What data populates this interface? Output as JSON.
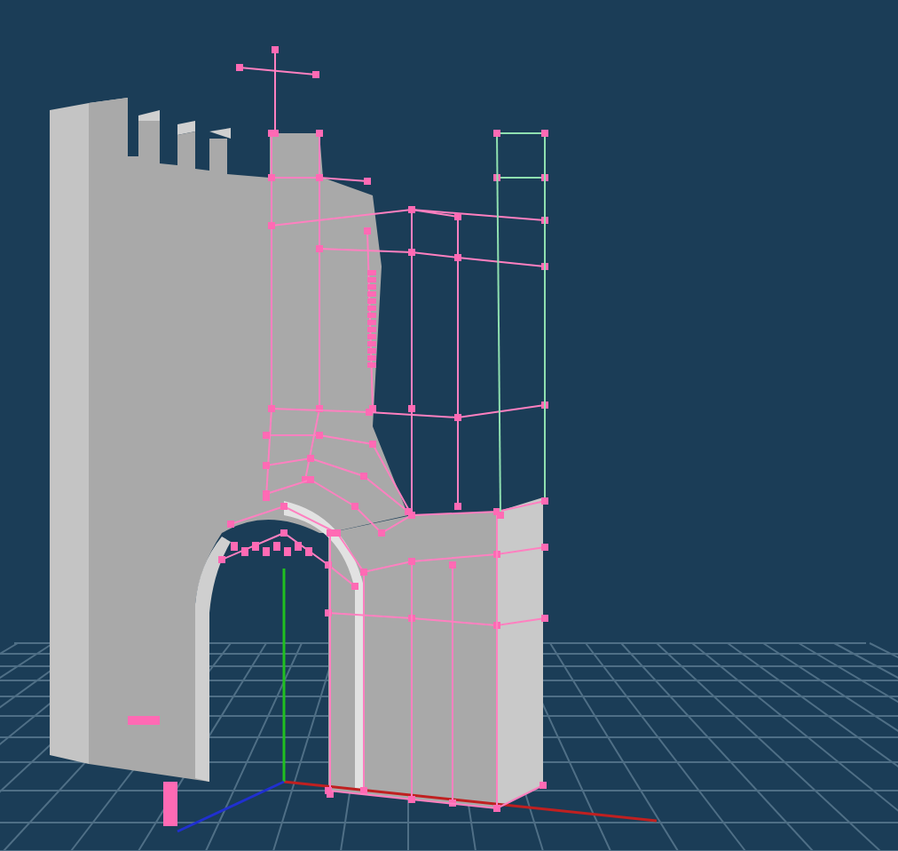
{
  "viewport": {
    "show_grid": true,
    "show_axes": true,
    "show_wireframe": true
  }
}
